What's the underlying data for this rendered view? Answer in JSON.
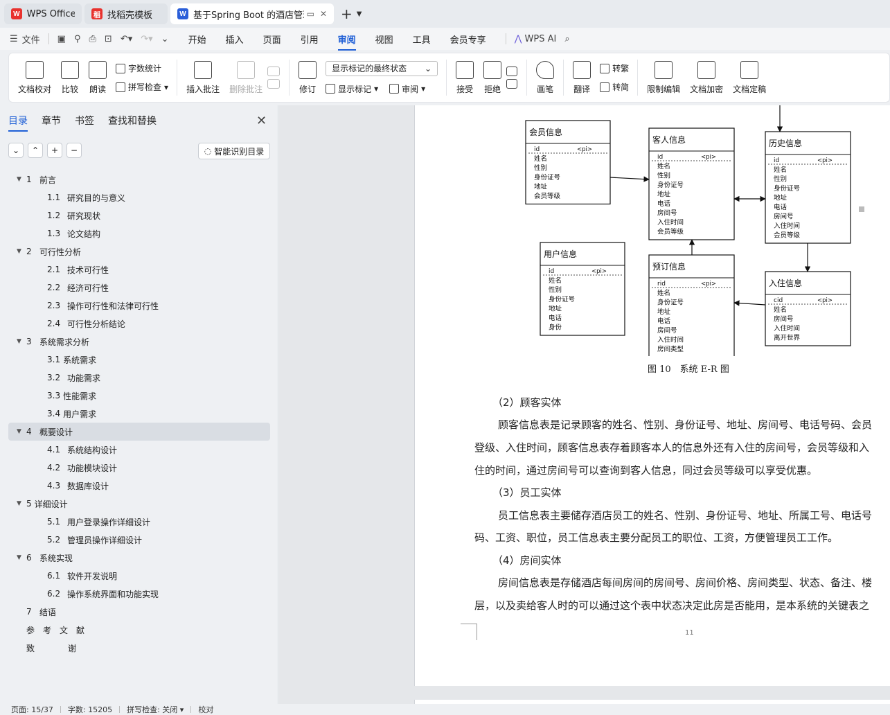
{
  "tabs": [
    {
      "label": "WPS Office",
      "logo": "W",
      "logo_color": "#e8322e"
    },
    {
      "label": "找稻壳模板",
      "logo": "稻",
      "logo_color": "#e8322e"
    },
    {
      "label": "基于Spring Boot 的酒店管理",
      "logo": "W",
      "logo_color": "#2b5fd9"
    }
  ],
  "menu": {
    "file": "文件",
    "items": [
      "开始",
      "插入",
      "页面",
      "引用",
      "审阅",
      "视图",
      "工具",
      "会员专享"
    ],
    "active": "审阅",
    "ai": "WPS AI"
  },
  "ribbon": {
    "doc_proof": "文档校对",
    "compare": "比较",
    "read": "朗读",
    "word_count": "字数统计",
    "spell_check": "拼写检查",
    "insert_comment": "插入批注",
    "delete_comment": "删除批注",
    "revise": "修订",
    "markup_select": "显示标记的最终状态",
    "show_markup": "显示标记",
    "review": "审阅",
    "accept": "接受",
    "reject": "拒绝",
    "pen": "画笔",
    "translate": "翻译",
    "to_traditional": "转繁",
    "to_simplified": "转简",
    "restrict_edit": "限制编辑",
    "encrypt": "文档加密",
    "finalize": "文档定稿"
  },
  "sidebar": {
    "tabs": [
      "目录",
      "章节",
      "书签",
      "查找和替换"
    ],
    "smart_toc": "智能识别目录",
    "toc": [
      {
        "num": "1",
        "label": "前言",
        "level": 1,
        "caret": true
      },
      {
        "num": "1.1",
        "label": "研究目的与意义",
        "level": 2
      },
      {
        "num": "1.2",
        "label": "研究现状",
        "level": 2
      },
      {
        "num": "1.3",
        "label": "论文结构",
        "level": 2
      },
      {
        "num": "2",
        "label": "可行性分析",
        "level": 1,
        "caret": true
      },
      {
        "num": "2.1",
        "label": "技术可行性",
        "level": 2
      },
      {
        "num": "2.2",
        "label": "经济可行性",
        "level": 2
      },
      {
        "num": "2.3",
        "label": "操作可行性和法律可行性",
        "level": 2
      },
      {
        "num": "2.4",
        "label": "可行性分析结论",
        "level": 2
      },
      {
        "num": "3",
        "label": "系统需求分析",
        "level": 1,
        "caret": true
      },
      {
        "num": "3.1",
        "label": "系统需求",
        "level": 2,
        "tight": true
      },
      {
        "num": "3.2",
        "label": "功能需求",
        "level": 2
      },
      {
        "num": "3.3",
        "label": "性能需求",
        "level": 2,
        "tight": true
      },
      {
        "num": "3.4",
        "label": "用户需求",
        "level": 2,
        "tight": true
      },
      {
        "num": "4",
        "label": "概要设计",
        "level": 1,
        "caret": true,
        "active": true
      },
      {
        "num": "4.1",
        "label": "系统结构设计",
        "level": 2
      },
      {
        "num": "4.2",
        "label": "功能模块设计",
        "level": 2
      },
      {
        "num": "4.3",
        "label": "数据库设计",
        "level": 2
      },
      {
        "num": "5",
        "label": "详细设计",
        "level": 1,
        "caret": true,
        "tight": true
      },
      {
        "num": "5.1",
        "label": "用户登录操作详细设计",
        "level": 2
      },
      {
        "num": "5.2",
        "label": "管理员操作详细设计",
        "level": 2
      },
      {
        "num": "6",
        "label": "系统实现",
        "level": 1,
        "caret": true
      },
      {
        "num": "6.1",
        "label": "软件开发说明",
        "level": 2
      },
      {
        "num": "6.2",
        "label": "操作系统界面和功能实现",
        "level": 2
      },
      {
        "num": "7",
        "label": "结语",
        "level": 1
      },
      {
        "num": "",
        "label": "参　考　文　献",
        "level": 1
      },
      {
        "num": "",
        "label": "致　　　　谢",
        "level": 1
      }
    ]
  },
  "er_diagram": {
    "entities": [
      {
        "title": "会员信息",
        "key": "id",
        "key_tag": "<pi>",
        "fields": [
          "姓名",
          "性别",
          "身份证号",
          "地址",
          "会员等级"
        ]
      },
      {
        "title": "客人信息",
        "key": "id",
        "key_tag": "<pi>",
        "fields": [
          "姓名",
          "性别",
          "身份证号",
          "地址",
          "电话",
          "房间号",
          "入住时间",
          "会员等级"
        ]
      },
      {
        "title": "历史信息",
        "key": "id",
        "key_tag": "<pi>",
        "fields": [
          "姓名",
          "性别",
          "身份证号",
          "地址",
          "电话",
          "房间号",
          "入住时间",
          "会员等级"
        ]
      },
      {
        "title": "用户信息",
        "key": "id",
        "key_tag": "<pi>",
        "fields": [
          "姓名",
          "性别",
          "身份证号",
          "地址",
          "电话",
          "身份"
        ]
      },
      {
        "title": "预订信息",
        "key": "rid",
        "key_tag": "<pi>",
        "fields": [
          "姓名",
          "身份证号",
          "地址",
          "电话",
          "房间号",
          "入住时间",
          "房间类型"
        ]
      },
      {
        "title": "入住信息",
        "key": "cid",
        "key_tag": "<pi>",
        "fields": [
          "姓名",
          "房间号",
          "入住时间",
          "离开世界"
        ]
      }
    ],
    "caption": "图 10　系统 E-R 图"
  },
  "body": {
    "h2": "（2）顾客实体",
    "p2a": "顾客信息表是记录顾客的姓名、性别、身份证号、地址、房间号、电话号码、会员",
    "p2b": "登级、入住时间，顾客信息表存着顾客本人的信息外还有入住的房间号，会员等级和入",
    "p2c": "住的时间，通过房间号可以查询到客人信息，同过会员等级可以享受优惠。",
    "h3": "（3）员工实体",
    "p3a": "员工信息表主要储存酒店员工的姓名、性别、身份证号、地址、所属工号、电话号",
    "p3b": "码、工资、职位，员工信息表主要分配员工的职位、工资，方便管理员工工作。",
    "h4": "（4）房间实体",
    "p4a": "房间信息表是存储酒店每间房间的房间号、房间价格、房间类型、状态、备注、楼",
    "p4b": "层，以及卖给客人时的可以通过这个表中状态决定此房是否能用，是本系统的关键表之",
    "page_number": "11"
  },
  "status": {
    "page": "页面: 15/37",
    "words": "字数: 15205",
    "spell": "拼写检查: 关闭",
    "proof": "校对"
  }
}
